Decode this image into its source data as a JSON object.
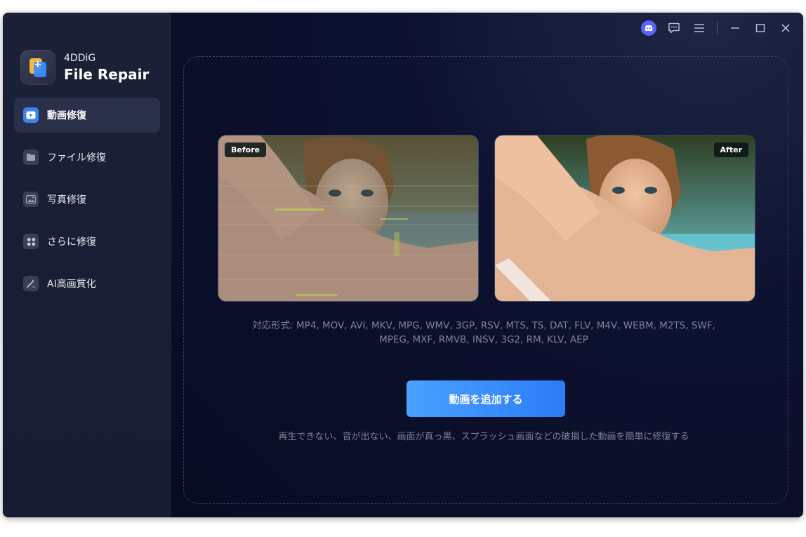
{
  "brand": {
    "small": "4DDiG",
    "big": "File Repair"
  },
  "sidebar": {
    "items": [
      {
        "label": "動画修復",
        "icon": "video-icon",
        "active": true
      },
      {
        "label": "ファイル修復",
        "icon": "folder-icon",
        "active": false
      },
      {
        "label": "写真修復",
        "icon": "image-icon",
        "active": false
      },
      {
        "label": "さらに修復",
        "icon": "grid-icon",
        "active": false
      },
      {
        "label": "AI高画質化",
        "icon": "magic-wand-icon",
        "active": false
      }
    ]
  },
  "titlebar": {
    "icons": [
      "discord-icon",
      "feedback-icon",
      "menu-icon",
      "minimize-icon",
      "maximize-icon",
      "close-icon"
    ]
  },
  "main": {
    "before_label": "Before",
    "after_label": "After",
    "formats_line1": "対応形式: MP4, MOV, AVI, MKV, MPG, WMV, 3GP, RSV, MTS, TS, DAT, FLV, M4V, WEBM, M2TS, SWF,",
    "formats_line2": "MPEG, MXF, RMVB, INSV, 3G2, RM, KLV, AEP",
    "add_button": "動画を追加する",
    "hint": "再生できない、音が出ない、画面が真っ黒、スプラッシュ画面などの破損した動画を簡単に修復する"
  },
  "colors": {
    "accent": "#3b82f6",
    "sidebar_bg": "#1b2037",
    "main_bg": "#0b0f24",
    "discord": "#5865f2"
  }
}
